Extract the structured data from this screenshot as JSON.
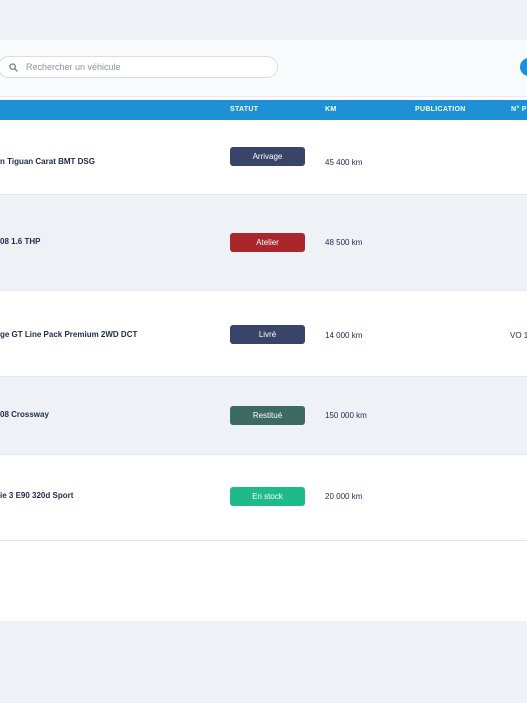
{
  "search": {
    "placeholder": "Rechercher un véhicule"
  },
  "columns": {
    "status": "STATUT",
    "km": "KM",
    "publication": "PUBLICATION",
    "ref": "N° P"
  },
  "rows": [
    {
      "name": "n Tiguan Carat BMT DSG",
      "status": "Arrivage",
      "status_color": "#3a4468",
      "km": "45 400 km",
      "publication": "",
      "ref": ""
    },
    {
      "name": "08 1.6 THP",
      "status": "Atelier",
      "status_color": "#a8262c",
      "km": "48 500 km",
      "publication": "",
      "ref": ""
    },
    {
      "name": "ge GT Line Pack Premium 2WD DCT",
      "status": "Livré",
      "status_color": "#3a4468",
      "km": "14 000 km",
      "publication": "",
      "ref": "VO 1"
    },
    {
      "name": "08 Crossway",
      "status": "Restitué",
      "status_color": "#3b6b62",
      "km": "150 000 km",
      "publication": "",
      "ref": ""
    },
    {
      "name": "ie 3 E90 320d Sport",
      "status": "En stock",
      "status_color": "#1fba8a",
      "km": "20 000 km",
      "publication": "",
      "ref": ""
    }
  ],
  "colors": {
    "header": "#1e90d6",
    "background": "#eef1f6",
    "accent_button": "#1e90d6"
  },
  "icons": {
    "search": "search-icon"
  }
}
